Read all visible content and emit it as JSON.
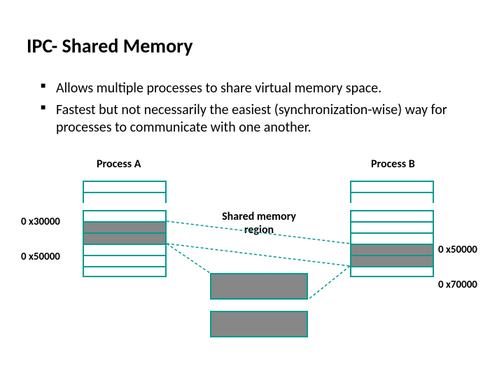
{
  "title": "IPC- Shared Memory",
  "bullets": [
    "Allows multiple processes to share virtual memory space.",
    "Fastest but not necessarily the easiest (synchronization-wise) way for processes to communicate with one another."
  ],
  "labels": {
    "processA": "Process A",
    "processB": "Process B",
    "sharedRegion": "Shared memory region"
  },
  "addresses": {
    "a_top": "0 x30000",
    "a_bottom": "0 x50000",
    "b_top": "0 x50000",
    "b_bottom": "0 x70000"
  },
  "colors": {
    "stroke": "#009a8e",
    "fill_shaded": "#878787"
  }
}
